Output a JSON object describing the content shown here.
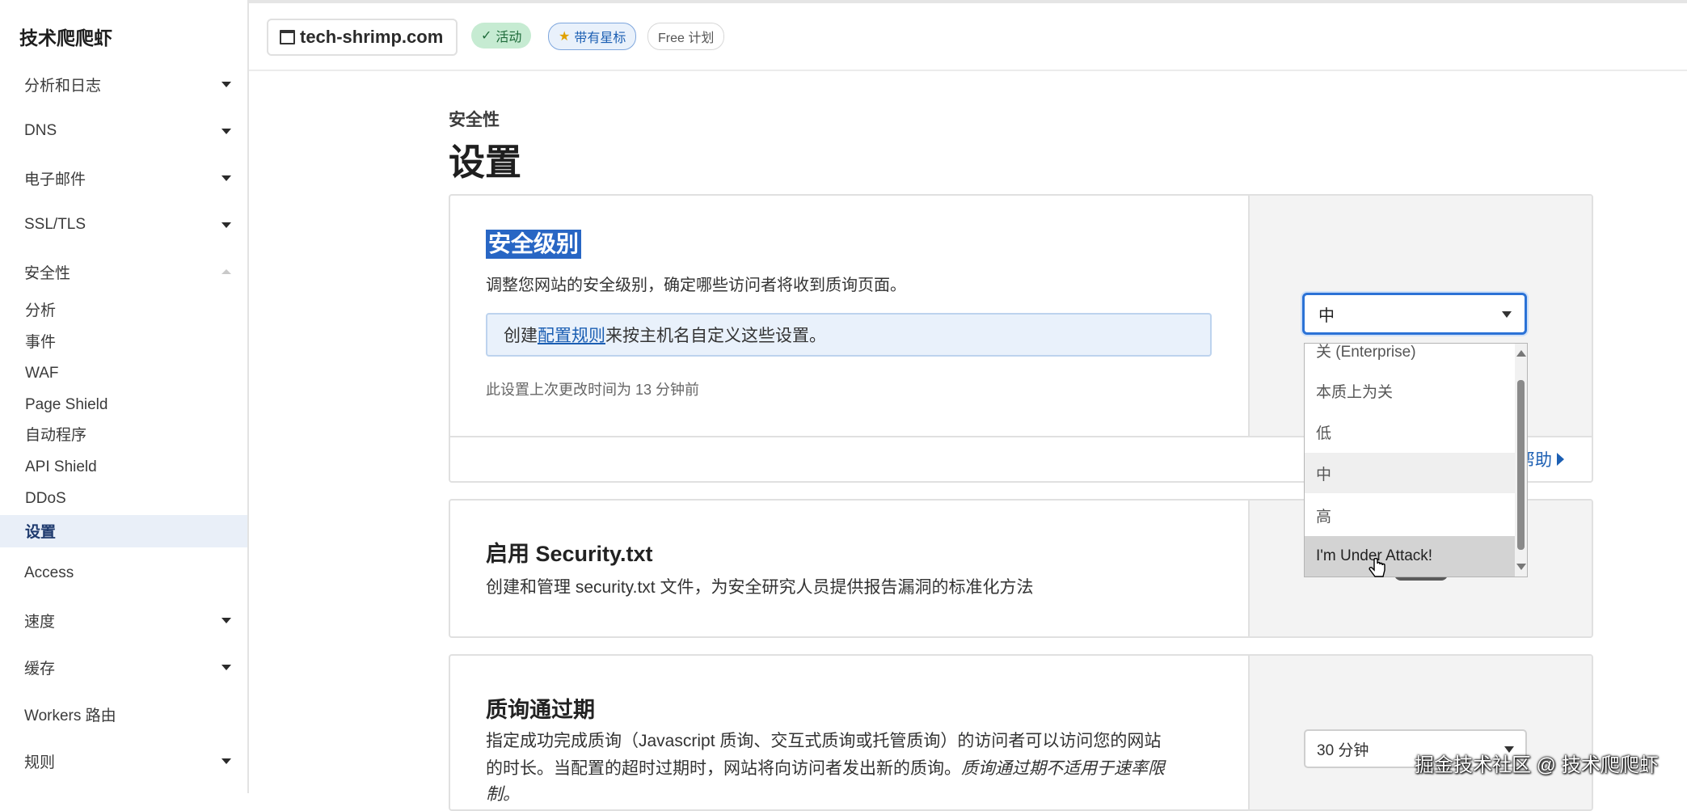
{
  "brand": "技术爬爬虾",
  "topbar": {
    "domain": "tech-shrimp.com",
    "badges": {
      "active": "活动",
      "starred": "带有星标",
      "plan": "Free 计划"
    }
  },
  "sidebar": {
    "items": [
      {
        "label": "分析和日志"
      },
      {
        "label": "DNS"
      },
      {
        "label": "电子邮件"
      },
      {
        "label": "SSL/TLS"
      },
      {
        "label": "安全性"
      }
    ],
    "security_sub": [
      "分析",
      "事件",
      "WAF",
      "Page Shield",
      "自动程序",
      "API Shield",
      "DDoS"
    ],
    "security_active": "设置",
    "lower_items": [
      {
        "label": "Access"
      },
      {
        "label": "速度"
      },
      {
        "label": "缓存"
      },
      {
        "label": "Workers 路由"
      },
      {
        "label": "规则"
      }
    ]
  },
  "main": {
    "breadcrumb": "安全性",
    "title": "设置",
    "security_level": {
      "title": "安全级别",
      "desc": "调整您网站的安全级别，确定哪些访问者将收到质询页面。",
      "info_prefix": "创建",
      "info_link": "配置规则",
      "info_suffix": "来按主机名自定义这些设置。",
      "last_changed": "此设置上次更改时间为 13 分钟前",
      "help": "帮助",
      "selected": "中",
      "options": [
        "关 (Enterprise)",
        "本质上为关",
        "低",
        "中",
        "高",
        "I'm Under Attack!"
      ]
    },
    "security_txt": {
      "title": "启用 Security.txt",
      "desc": "创建和管理 security.txt 文件，为安全研究人员提供报告漏洞的标准化方法"
    },
    "challenge_passage": {
      "title": "质询通过期",
      "desc_line1": "指定成功完成质询（Javascript 质询、交互式质询或托管质询）的访问者可以访问您的网站",
      "desc_line2": "的时长。当配置的超时过期时，网站将向访问者发出新的质询。",
      "desc_italic": "质询通过期不适用于速率限",
      "desc_line3": "制。",
      "value": "30 分钟"
    }
  },
  "watermark": "掘金技术社区 @ 技术爬爬虾",
  "colors": {
    "accent": "#2b72d6",
    "highlight": "#2866c4",
    "active_badge": "#c6ebd2"
  }
}
